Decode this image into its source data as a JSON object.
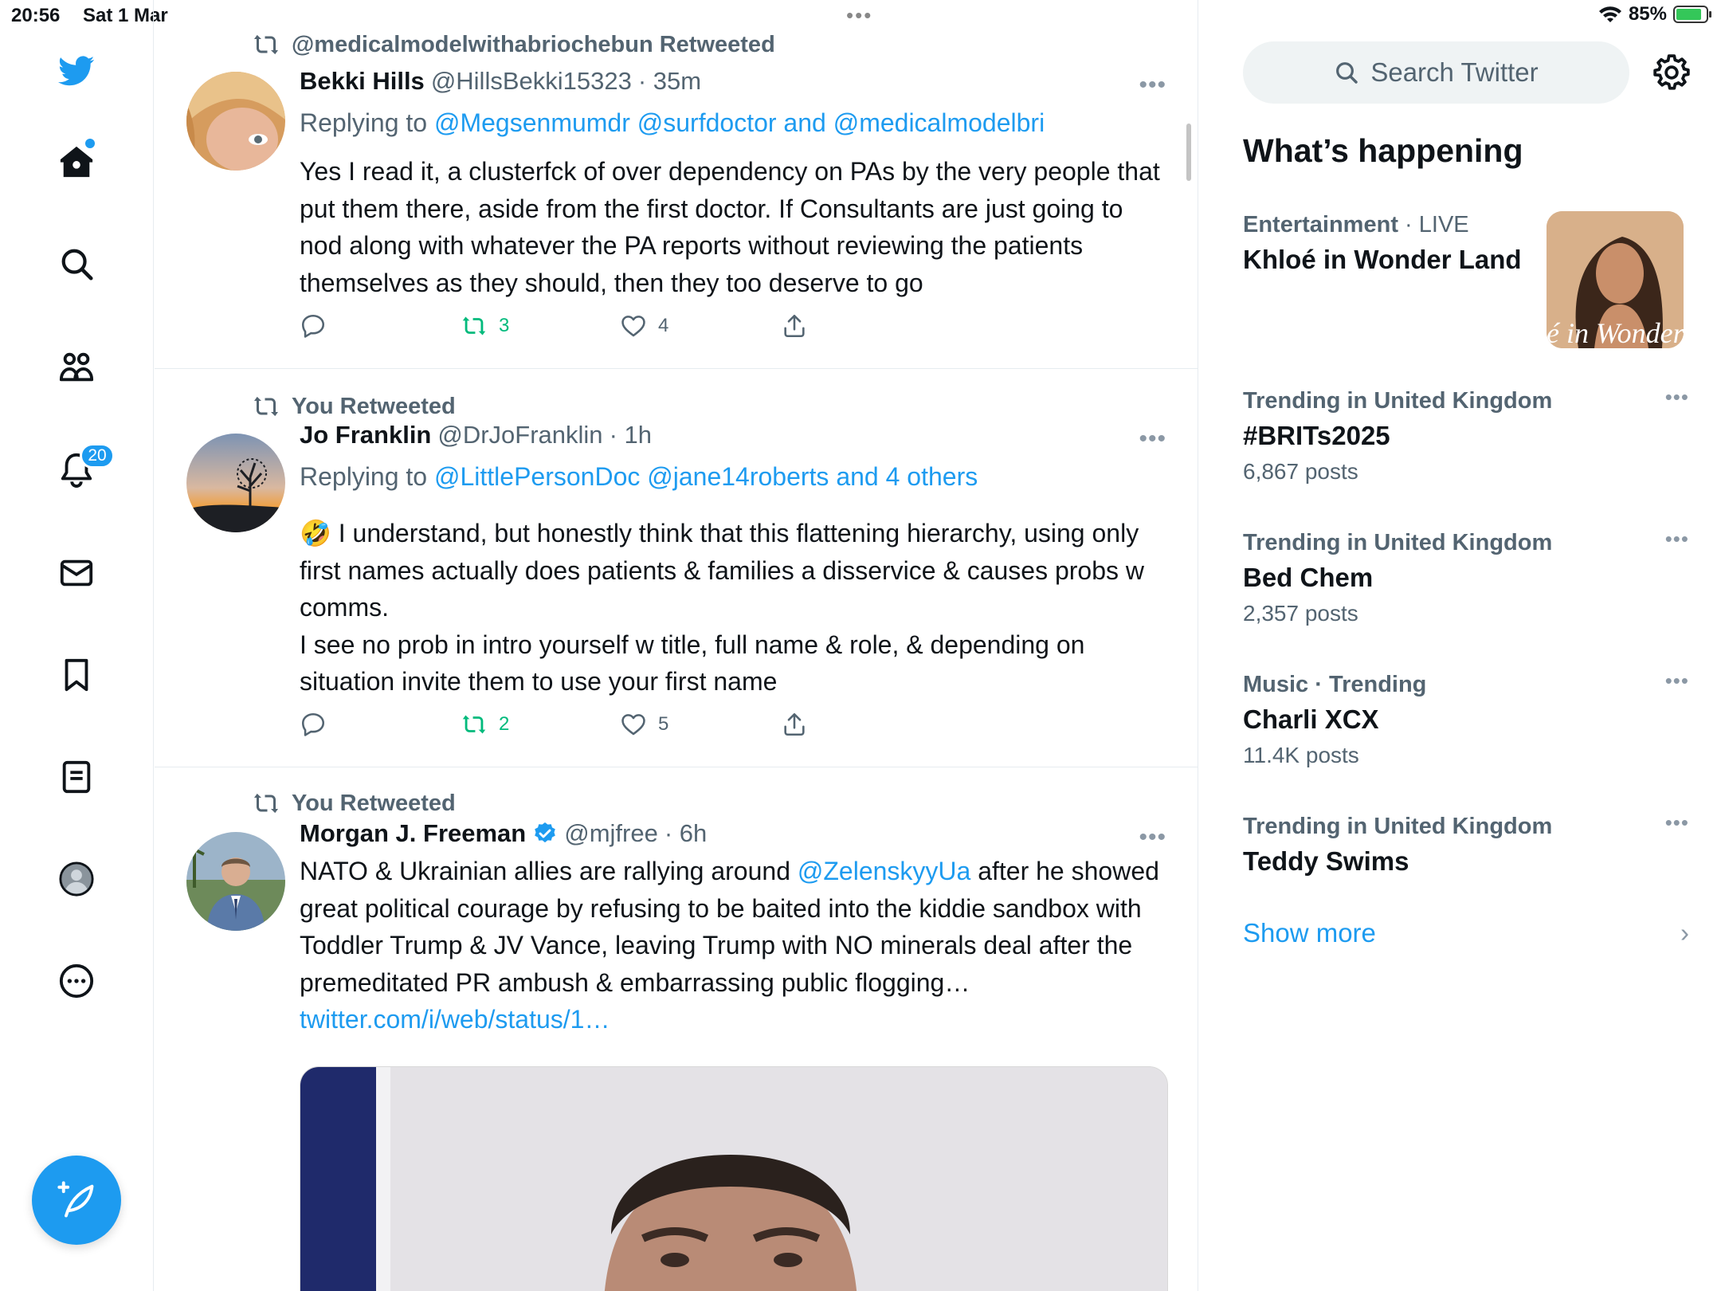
{
  "status_bar": {
    "time": "20:56",
    "date": "Sat 1 Mar",
    "battery": "85%"
  },
  "nav": {
    "notifications_badge": "20"
  },
  "tweets": [
    {
      "retweet_label": "@medicalmodelwithabriochebun Retweeted",
      "name": "Bekki Hills",
      "handle": "@HillsBekki15323",
      "time": "· 35m",
      "replying_prefix": "Replying to",
      "replying_targets": "@Megsenmumdr @surfdoctor and @medicalmodelbri",
      "text": "Yes I read it, a clusterfck of over dependency on PAs by the very people that put them there, aside from the first doctor. If Consultants are just going to nod along with whatever the PA reports without reviewing the patients themselves as they should, then they too deserve to go",
      "retweets": "3",
      "likes": "4"
    },
    {
      "retweet_label": "You Retweeted",
      "name": "Jo Franklin",
      "handle": "@DrJoFranklin",
      "time": "· 1h",
      "replying_prefix": "Replying to",
      "replying_targets": "@LittlePersonDoc @jane14roberts and 4 others",
      "text_line1": "🤣 I understand, but honestly think that this flattening hierarchy, using only first names actually does patients & families a disservice & causes probs w comms.",
      "text_line2": "I see no prob in intro yourself w title, full name & role, & depending on situation invite them to use your first name",
      "retweets": "2",
      "likes": "5"
    },
    {
      "retweet_label": "You Retweeted",
      "name": "Morgan J. Freeman",
      "handle": "@mjfree",
      "time": "· 6h",
      "text_before": "NATO & Ukrainian allies are rallying around ",
      "mention": "@ZelenskyyUa",
      "text_after": " after he showed great political courage by refusing to be baited into the kiddie sandbox with Toddler Trump & JV Vance, leaving Trump with NO minerals deal after the premeditated PR ambush & embarrassing public flogging… ",
      "link": "twitter.com/i/web/status/1…"
    }
  ],
  "sidebar": {
    "search_placeholder": "Search Twitter",
    "section_title": "What’s happening",
    "trends": [
      {
        "category": "Entertainment",
        "extra": "· LIVE",
        "name": "Khloé in Wonder Land",
        "count": "",
        "thumb_text": "é in Wonder L"
      },
      {
        "category": "Trending in United Kingdom",
        "extra": "",
        "name": "#BRITs2025",
        "count": "6,867 posts"
      },
      {
        "category": "Trending in United Kingdom",
        "extra": "",
        "name": "Bed Chem",
        "count": "2,357 posts"
      },
      {
        "category": "Music · Trending",
        "extra": "",
        "name": "Charli XCX",
        "count": "11.4K posts"
      },
      {
        "category": "Trending in United Kingdom",
        "extra": "",
        "name": "Teddy Swims",
        "count": ""
      }
    ],
    "show_more": "Show more"
  },
  "colors": {
    "accent": "#1d9bf0",
    "retweet_green": "#00ba7c",
    "muted": "#536471"
  }
}
